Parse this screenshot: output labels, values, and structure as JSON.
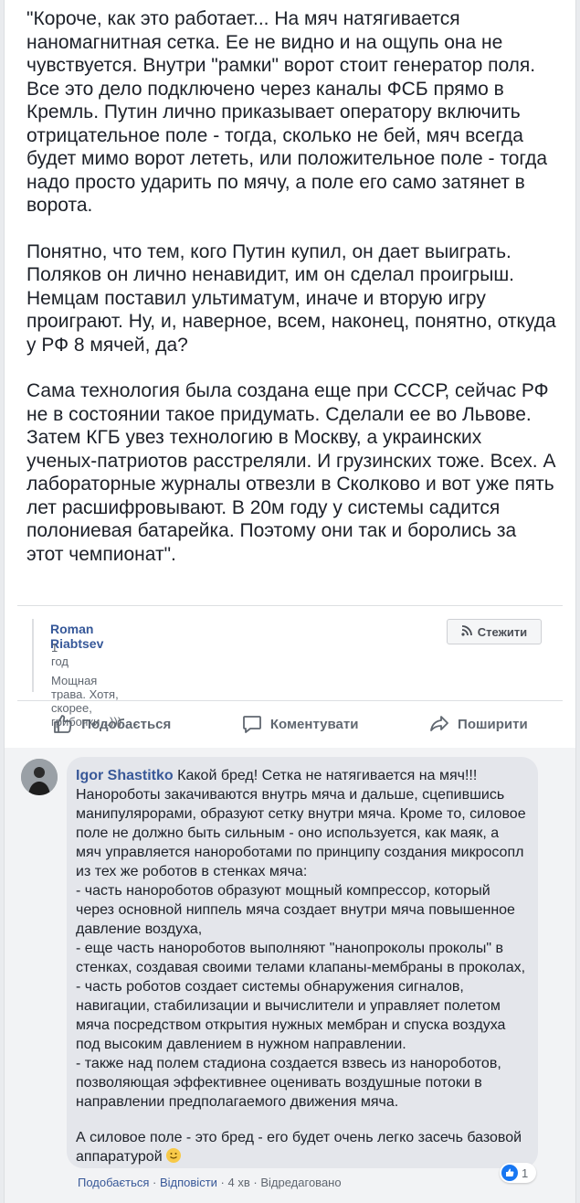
{
  "post": {
    "paragraphs": [
      "\"Короче, как это работает... На мяч натягивается наномагнитная сетка. Ее не видно и на ощупь она не чувствуется. Внутри \"рамки\" ворот стоит генератор поля. Все это дело подключено через каналы ФСБ прямо в Кремль. Путин лично приказывает оператору включить отрицательное поле - тогда, сколько не бей, мяч всегда будет мимо ворот лететь, или положительное поле - тогда надо просто ударить по мячу, а поле его само затянет в ворота.",
      "Понятно, что тем, кого Путин купил, он дает выиграть. Поляков он лично ненавидит, им он сделал проигрыш. Немцам поставил ультиматум, иначе и вторую игру проиграют. Ну, и, наверное, всем, наконец, понятно, откуда у РФ 8 мячей, да?",
      "Сама технология была создана еще при СССР, сейчас РФ не в состоянии такое придумать. Сделали ее во Львове. Затем КГБ увез технологию в Москву, а украинских ученых-патриотов расстреляли. И грузинских тоже. Всех. А лабораторные журналы отвезли в Сколково и вот уже пять лет расшифровывают. В 20м году у системы садится полониевая батарейка. Поэтому они так и боролись за этот чемпионат\"."
    ]
  },
  "shared": {
    "author": "Roman Riabtsev",
    "time": "1 год",
    "text": "Мощная трава. Хотя, скорее, грибочки...)))",
    "follow_label": "Стежити"
  },
  "actions": {
    "like": "Подобається",
    "comment": "Коментувати",
    "share": "Поширити"
  },
  "comment": {
    "author": "Igor Shastitko",
    "intro": "Какой бред! Сетка не натягивается на мяч!!! Нанороботы закачиваются внутрь мяча и дальше, сцепившись манипулярорами, образуют сетку внутри мяча. Кроме то, силовое поле не должно быть сильным - оно используется, как маяк, а мяч управляется нанороботами по принципу создания микросопл из тех же роботов в стенках мяча:",
    "items": [
      "- часть нанороботов образуют мощный компрессор, который через основной ниппель мяча создает внутри мяча повышенное давление воздуха,",
      "- еще часть нанороботов выполняют \"нанопроколы проколы\" в стенках, создавая своими телами клапаны-мембраны в проколах,",
      "- часть роботов создает системы обнаружения сигналов, навигации, стабилизации и вычислители и управляет полетом мяча посредством открытия нужных мембран и спуска воздуха под высоким давлением в нужном направлении.",
      "- также над полем стадиона создается взвесь из нанороботов, позволяющая эффективнее оценивать воздушные потоки в направлении предполагаемого движения мяча."
    ],
    "closing": "А силовое поле - это бред - его будет очень легко засечь базовой аппаратурой",
    "reaction_count": "1",
    "meta": {
      "like": "Подобається",
      "reply": "Відповісти",
      "time": "4 хв",
      "edited": "Відредаговано",
      "sep": "·"
    }
  }
}
